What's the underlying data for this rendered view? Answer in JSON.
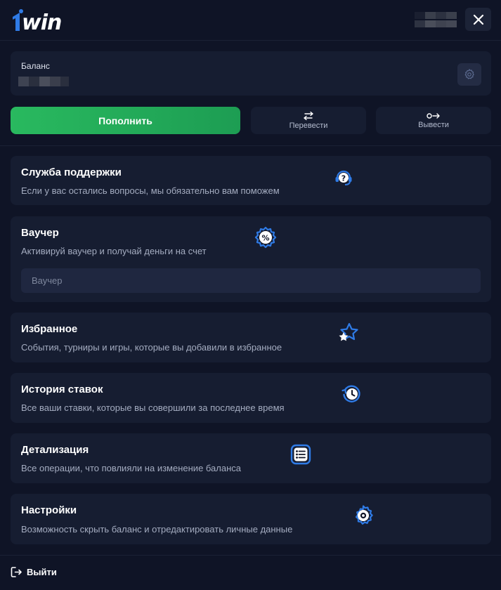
{
  "header": {
    "logo_text": "1win",
    "close_icon": "close-icon"
  },
  "balance": {
    "label": "Баланс",
    "settings_icon": "gear-icon"
  },
  "actions": {
    "deposit_label": "Пополнить",
    "transfer_label": "Перевести",
    "transfer_icon": "transfer-arrows-icon",
    "withdraw_label": "Вывести",
    "withdraw_icon": "withdraw-arrow-icon"
  },
  "menu": {
    "support": {
      "title": "Служба поддержки",
      "description": "Если у вас остались вопросы, мы обязательно вам поможем",
      "icon": "headset-question-icon"
    },
    "voucher": {
      "title": "Ваучер",
      "description": "Активируй ваучер и получай деньги на счет",
      "input_placeholder": "Ваучер",
      "input_value": "",
      "icon": "percent-badge-icon"
    },
    "favorites": {
      "title": "Избранное",
      "description": "События, турниры и игры, которые вы добавили в избранное",
      "icon": "star-icon"
    },
    "history": {
      "title": "История ставок",
      "description": "Все ваши ставки, которые вы совершили за последнее время",
      "icon": "history-clock-icon"
    },
    "details": {
      "title": "Детализация",
      "description": "Все операции, что повлияли на изменение баланса",
      "icon": "list-icon"
    },
    "settings": {
      "title": "Настройки",
      "description": "Возможность скрыть баланс и отредактировать личные данные",
      "icon": "gear-icon"
    }
  },
  "footer": {
    "logout_label": "Выйти",
    "logout_icon": "logout-icon"
  },
  "colors": {
    "background": "#0f1426",
    "card": "#161d31",
    "accent_blue": "#2f7be6",
    "deposit_green": "#29b95f",
    "muted_text": "#a4acc0"
  }
}
